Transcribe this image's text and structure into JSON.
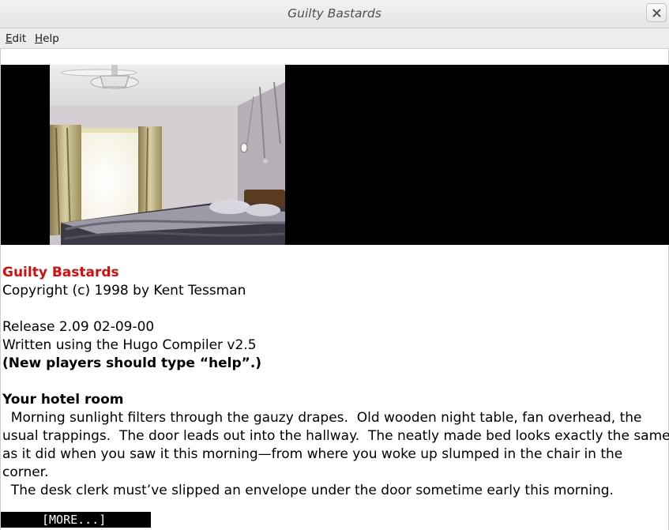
{
  "window": {
    "title": "Guilty Bastards"
  },
  "menu": {
    "items": [
      {
        "mnemonic": "E",
        "rest": "dit"
      },
      {
        "mnemonic": "H",
        "rest": "elp"
      }
    ]
  },
  "icons": {
    "close": "close-icon"
  },
  "picture": {
    "scene": "hotel room with ceiling fan, curtained window and bed"
  },
  "story": {
    "game_title": "Guilty Bastards",
    "copyright": "Copyright (c) 1998 by Kent Tessman",
    "release": "Release 2.09 02-09-00",
    "compiler": "Written using the Hugo Compiler v2.5",
    "hint": "(New players should type “help”.)",
    "room_name": "Your hotel room",
    "description_lines": [
      "  Morning sunlight filters through the gauzy drapes.  Old wooden night table, fan overhead, the",
      "usual trappings.  The door leads out into the hallway.  The neatly made bed looks exactly the same",
      "as it did when you saw it this morning—from where you woke up slumped in the chair in the",
      "corner.",
      "  The desk clerk must’ve slipped an envelope under the door sometime early this morning."
    ]
  },
  "prompt": {
    "more": "[MORE...]"
  },
  "colors": {
    "title_accent": "#d40d0d",
    "picture_background": "#000000",
    "more_background": "#000000"
  }
}
